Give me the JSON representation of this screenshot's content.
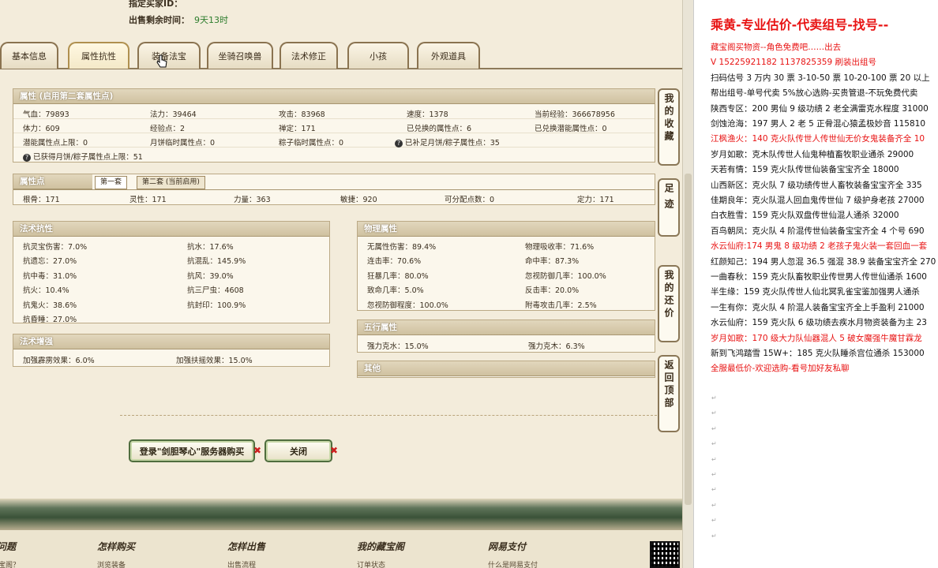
{
  "top": {
    "seller_id_label": "指定买家ID：",
    "time_left_label": "出售剩余时间：",
    "time_left_value": "9天13时"
  },
  "tabs": [
    "基本信息",
    "属性抗性",
    "装备法宝",
    "坐骑召唤兽",
    "法术修正",
    "小孩",
    "外观道具"
  ],
  "attr": {
    "title": "属性 (启用第二套属性点)",
    "rows": [
      [
        "气血：79893",
        "法力：39464",
        "攻击：83968",
        "速度：1378",
        "当前经验：366678956"
      ],
      [
        "体力：609",
        "经验点：2",
        "禅定：171",
        "已兑换的属性点：6",
        "已兑换潜能属性点：0"
      ],
      [
        "潜能属性点上限：0",
        "月饼临时属性点：0",
        "粽子临时属性点：0",
        "已补足月饼/粽子属性点：35",
        ""
      ]
    ],
    "extra": "已获得月饼/粽子属性点上限：51"
  },
  "points": {
    "title": "属性点",
    "tab1": "第一套",
    "tab2": "第二套 (当前启用)",
    "values": [
      "根骨：171",
      "灵性：171",
      "力量：363",
      "敏捷：920",
      "可分配点数：0",
      "定力：171"
    ]
  },
  "magic_resist": {
    "title": "法术抗性",
    "rows": [
      [
        "抗灵宝伤害：7.0%",
        "抗水：17.6%"
      ],
      [
        "抗遗忘：27.0%",
        "抗混乱：145.9%"
      ],
      [
        "抗中毒：31.0%",
        "抗风：39.0%"
      ],
      [
        "抗火：10.4%",
        "抗三尸虫：4608"
      ],
      [
        "抗鬼火：38.6%",
        "抗封印：100.9%"
      ],
      [
        "抗昏睡：27.0%",
        ""
      ]
    ]
  },
  "magic_boost": {
    "title": "法术增强",
    "rows": [
      [
        "加强霹雳效果：6.0%",
        "加强扶摇效果：15.0%"
      ]
    ]
  },
  "phys": {
    "title": "物理属性",
    "rows": [
      [
        "无属性伤害：89.4%",
        "物理吸收率：71.6%"
      ],
      [
        "连击率：70.6%",
        "命中率：87.3%"
      ],
      [
        "狂暴几率：80.0%",
        "忽视防御几率：100.0%"
      ],
      [
        "致命几率：5.0%",
        "反击率：20.0%"
      ],
      [
        "忽视防御程度：100.0%",
        "附毒攻击几率：2.5%"
      ]
    ]
  },
  "five": {
    "title": "五行属性",
    "rows": [
      [
        "强力克水：15.0%",
        "强力克木：6.3%"
      ]
    ]
  },
  "other": {
    "title": "其他"
  },
  "side": [
    "我的收藏",
    "足迹",
    "我的还价",
    "返回顶部"
  ],
  "buttons": {
    "buy": "登录\"剑胆琴心\"服务器购买",
    "close": "关闭"
  },
  "footer": {
    "cols": [
      "问题",
      "怎样购买",
      "怎样出售",
      "我的藏宝阁",
      "网易支付"
    ],
    "links": [
      "宝阁？",
      "浏览装备",
      "出售流程",
      "订单状态",
      "什么是网易支付"
    ]
  },
  "doc": {
    "title": "乘黄-专业估价-代卖组号-找号--",
    "lines": [
      {
        "t": "藏宝阁买物资--角色免费吧……出去",
        "red": true
      },
      {
        "t": "V 15225921182 1137825359 刷装出组号",
        "red": true
      },
      {
        "t": "扫码估号 3 万内 30 票 3-10-50 票 10-20-100 票 20 以上",
        "red": false
      },
      {
        "t": "帮出组号-单号代卖 5%放心选购-买贵管退-不玩免费代卖",
        "red": false
      },
      {
        "t": "陕西专区：200 男仙 9 级功绩 2 老全满雷克水程度 31000",
        "red": false
      },
      {
        "t": "剑蚀沧海：197 男人 2 老 5 正骨混心猿孟极妙音 115810",
        "red": false
      },
      {
        "t": "江枫渔火：140 克火队传世人传世仙无价女鬼装备齐全 10",
        "red": true
      },
      {
        "t": "岁月如歌：克木队传世人仙鬼种植畜牧职业通杀 29000",
        "red": false
      },
      {
        "t": "天若有情：159 克火队传世仙装备宝宝齐全 18000",
        "red": false
      },
      {
        "t": "山西新区：克火队 7 级功绩传世人畜牧装备宝宝齐全 335",
        "red": false
      },
      {
        "t": "佳期良年：克火队混人回血鬼传世仙 7 级护身老孩 27000",
        "red": false
      },
      {
        "t": "白衣胜雪：159 克火队双盘传世仙混人通杀 32000",
        "red": false
      },
      {
        "t": "百鸟朝凤：克火队 4 阶混传世仙装备宝宝齐全 4 个号 690",
        "red": false
      },
      {
        "t": "水云仙府:174 男鬼 8 级功绩 2 老孩子鬼火装一套回血一套",
        "red": true
      },
      {
        "t": "红颜知己：194 男人忽混 36.5 强混 38.9 装备宝宝齐全 270",
        "red": false
      },
      {
        "t": "一曲春秋：159 克火队畜牧职业传世男人传世仙通杀 1600",
        "red": false
      },
      {
        "t": "半生缘：159 克火队传世人仙北冥乳雀宝鉴加强男人通杀",
        "red": false
      },
      {
        "t": "一生有你：克火队 4 阶混人装备宝宝齐全上手盈利 21000",
        "red": false
      },
      {
        "t": "水云仙府：159 克火队 6 级功绩去疾水月物资装备为主 23",
        "red": false
      },
      {
        "t": "岁月如歌：170 级大力队仙器混人 5 破女魔强牛魔甘霖龙",
        "red": true
      },
      {
        "t": "新到飞鸿踏雪 15W+：185 克火队睡杀宫位通杀 153000",
        "red": false
      },
      {
        "t": "全服最低价-欢迎选购-看号加好友私聊",
        "red": true
      }
    ]
  }
}
